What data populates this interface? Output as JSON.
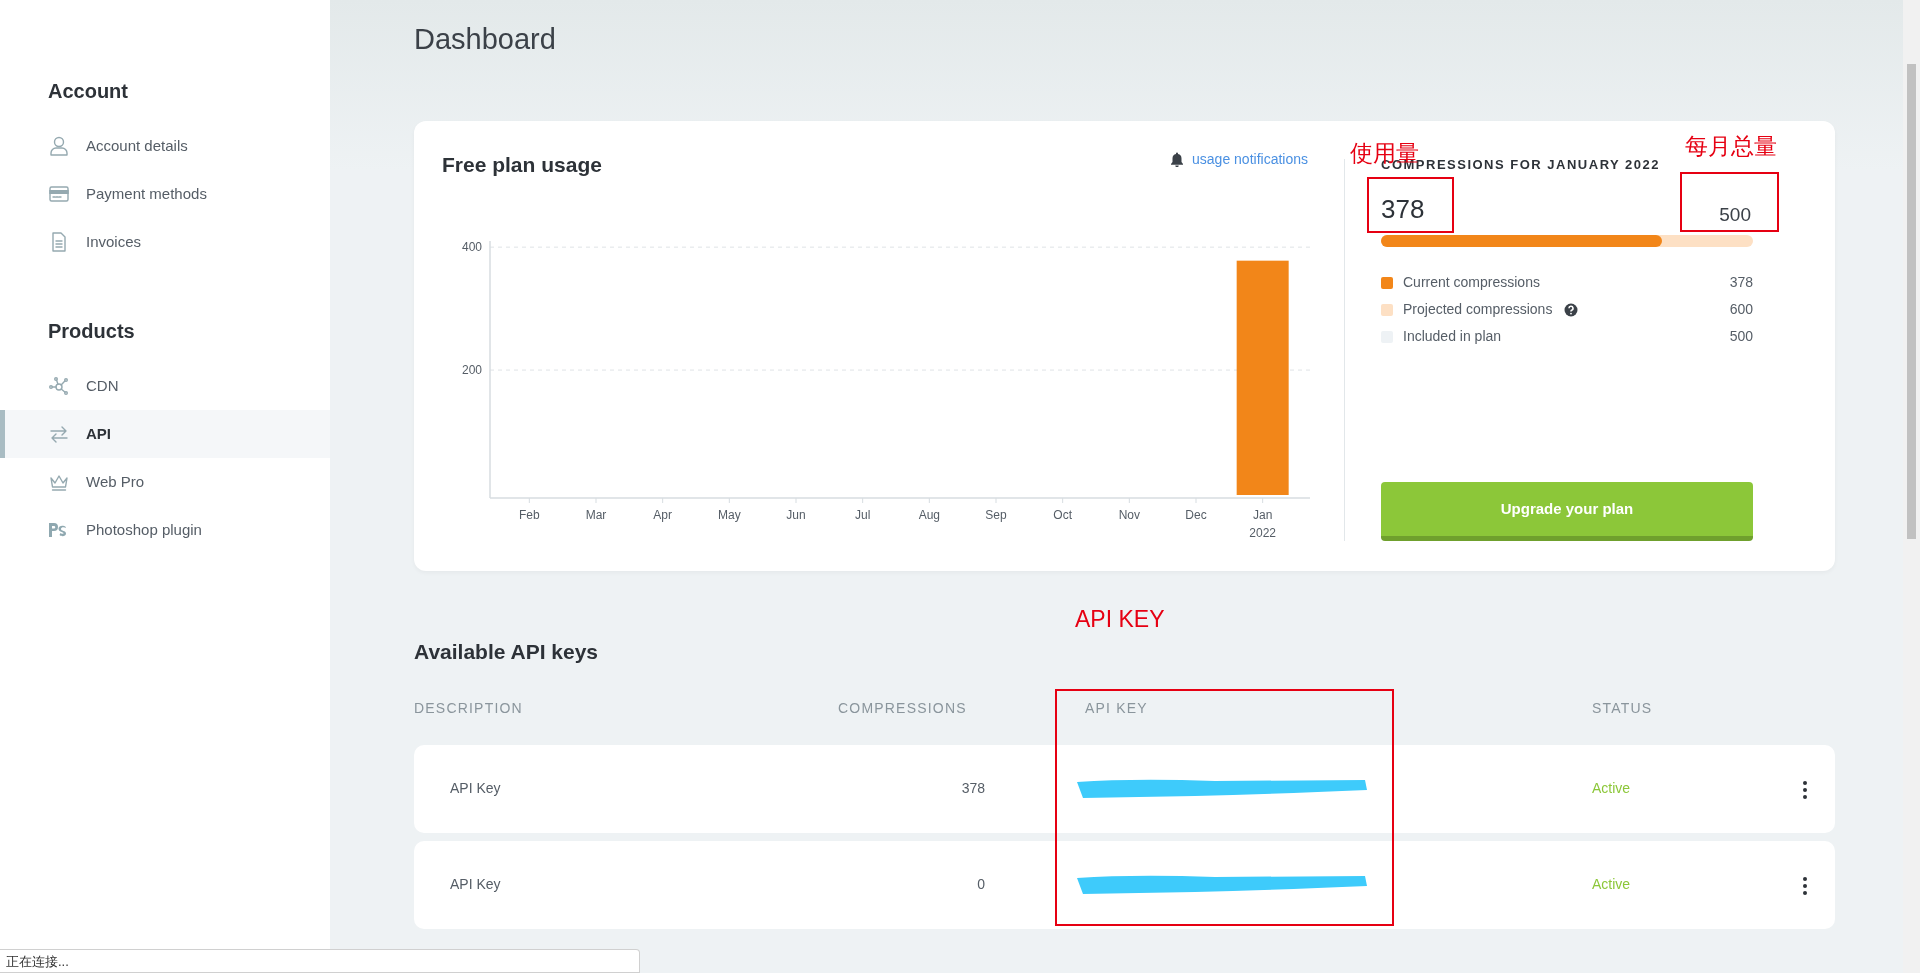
{
  "sidebar": {
    "sections": [
      {
        "heading": "Account",
        "items": [
          {
            "label": "Account details",
            "kind": "person",
            "selected": false
          },
          {
            "label": "Payment methods",
            "kind": "card",
            "selected": false
          },
          {
            "label": "Invoices",
            "kind": "document",
            "selected": false
          }
        ]
      },
      {
        "heading": "Products",
        "items": [
          {
            "label": "CDN",
            "kind": "network",
            "selected": false
          },
          {
            "label": "API",
            "kind": "arrows",
            "selected": true
          },
          {
            "label": "Web Pro",
            "kind": "crown",
            "selected": false
          },
          {
            "label": "Photoshop plugin",
            "kind": "ps",
            "selected": false
          }
        ]
      }
    ]
  },
  "page_title": "Dashboard",
  "usage": {
    "title": "Free plan usage",
    "link": "usage notifications",
    "chart_data": {
      "type": "bar",
      "categories": [
        "Feb",
        "Mar",
        "Apr",
        "May",
        "Jun",
        "Jul",
        "Aug",
        "Sep",
        "Oct",
        "Nov",
        "Dec",
        "Jan"
      ],
      "series": [
        {
          "color": "#f28619",
          "values": [
            0,
            0,
            0,
            0,
            0,
            0,
            0,
            0,
            0,
            0,
            0,
            378
          ]
        }
      ],
      "ylim": [
        0,
        410
      ],
      "yticks": [
        200,
        400
      ],
      "xlabel": "2022"
    }
  },
  "summary": {
    "heading": "COMPRESSIONS FOR JANUARY 2022",
    "used": "378",
    "total": "500",
    "level": 0.756,
    "legend": [
      {
        "label": "Current compressions",
        "value": "378",
        "color": "#f28619",
        "help": false
      },
      {
        "label": "Projected compressions",
        "value": "600",
        "color": "#fde0c4",
        "help": true
      },
      {
        "label": "Included in plan",
        "value": "500",
        "color": "#eef2f5",
        "help": false
      }
    ],
    "button": "Upgrade your plan"
  },
  "api_keys": {
    "title": "Available API keys",
    "columns": [
      "DESCRIPTION",
      "COMPRESSIONS",
      "API KEY",
      "STATUS"
    ],
    "rows": [
      {
        "description": "API Key",
        "compressions": "378",
        "key_redacted": true,
        "status": "Active"
      },
      {
        "description": "API Key",
        "compressions": "0",
        "key_redacted": true,
        "status": "Active"
      }
    ]
  },
  "annotations": [
    {
      "kind": "label",
      "text": "使用量"
    },
    {
      "kind": "box"
    },
    {
      "kind": "label",
      "text": "每月总量"
    },
    {
      "kind": "box"
    },
    {
      "kind": "label",
      "text": "API KEY"
    },
    {
      "kind": "box"
    }
  ],
  "status_bar": "正在连接..."
}
